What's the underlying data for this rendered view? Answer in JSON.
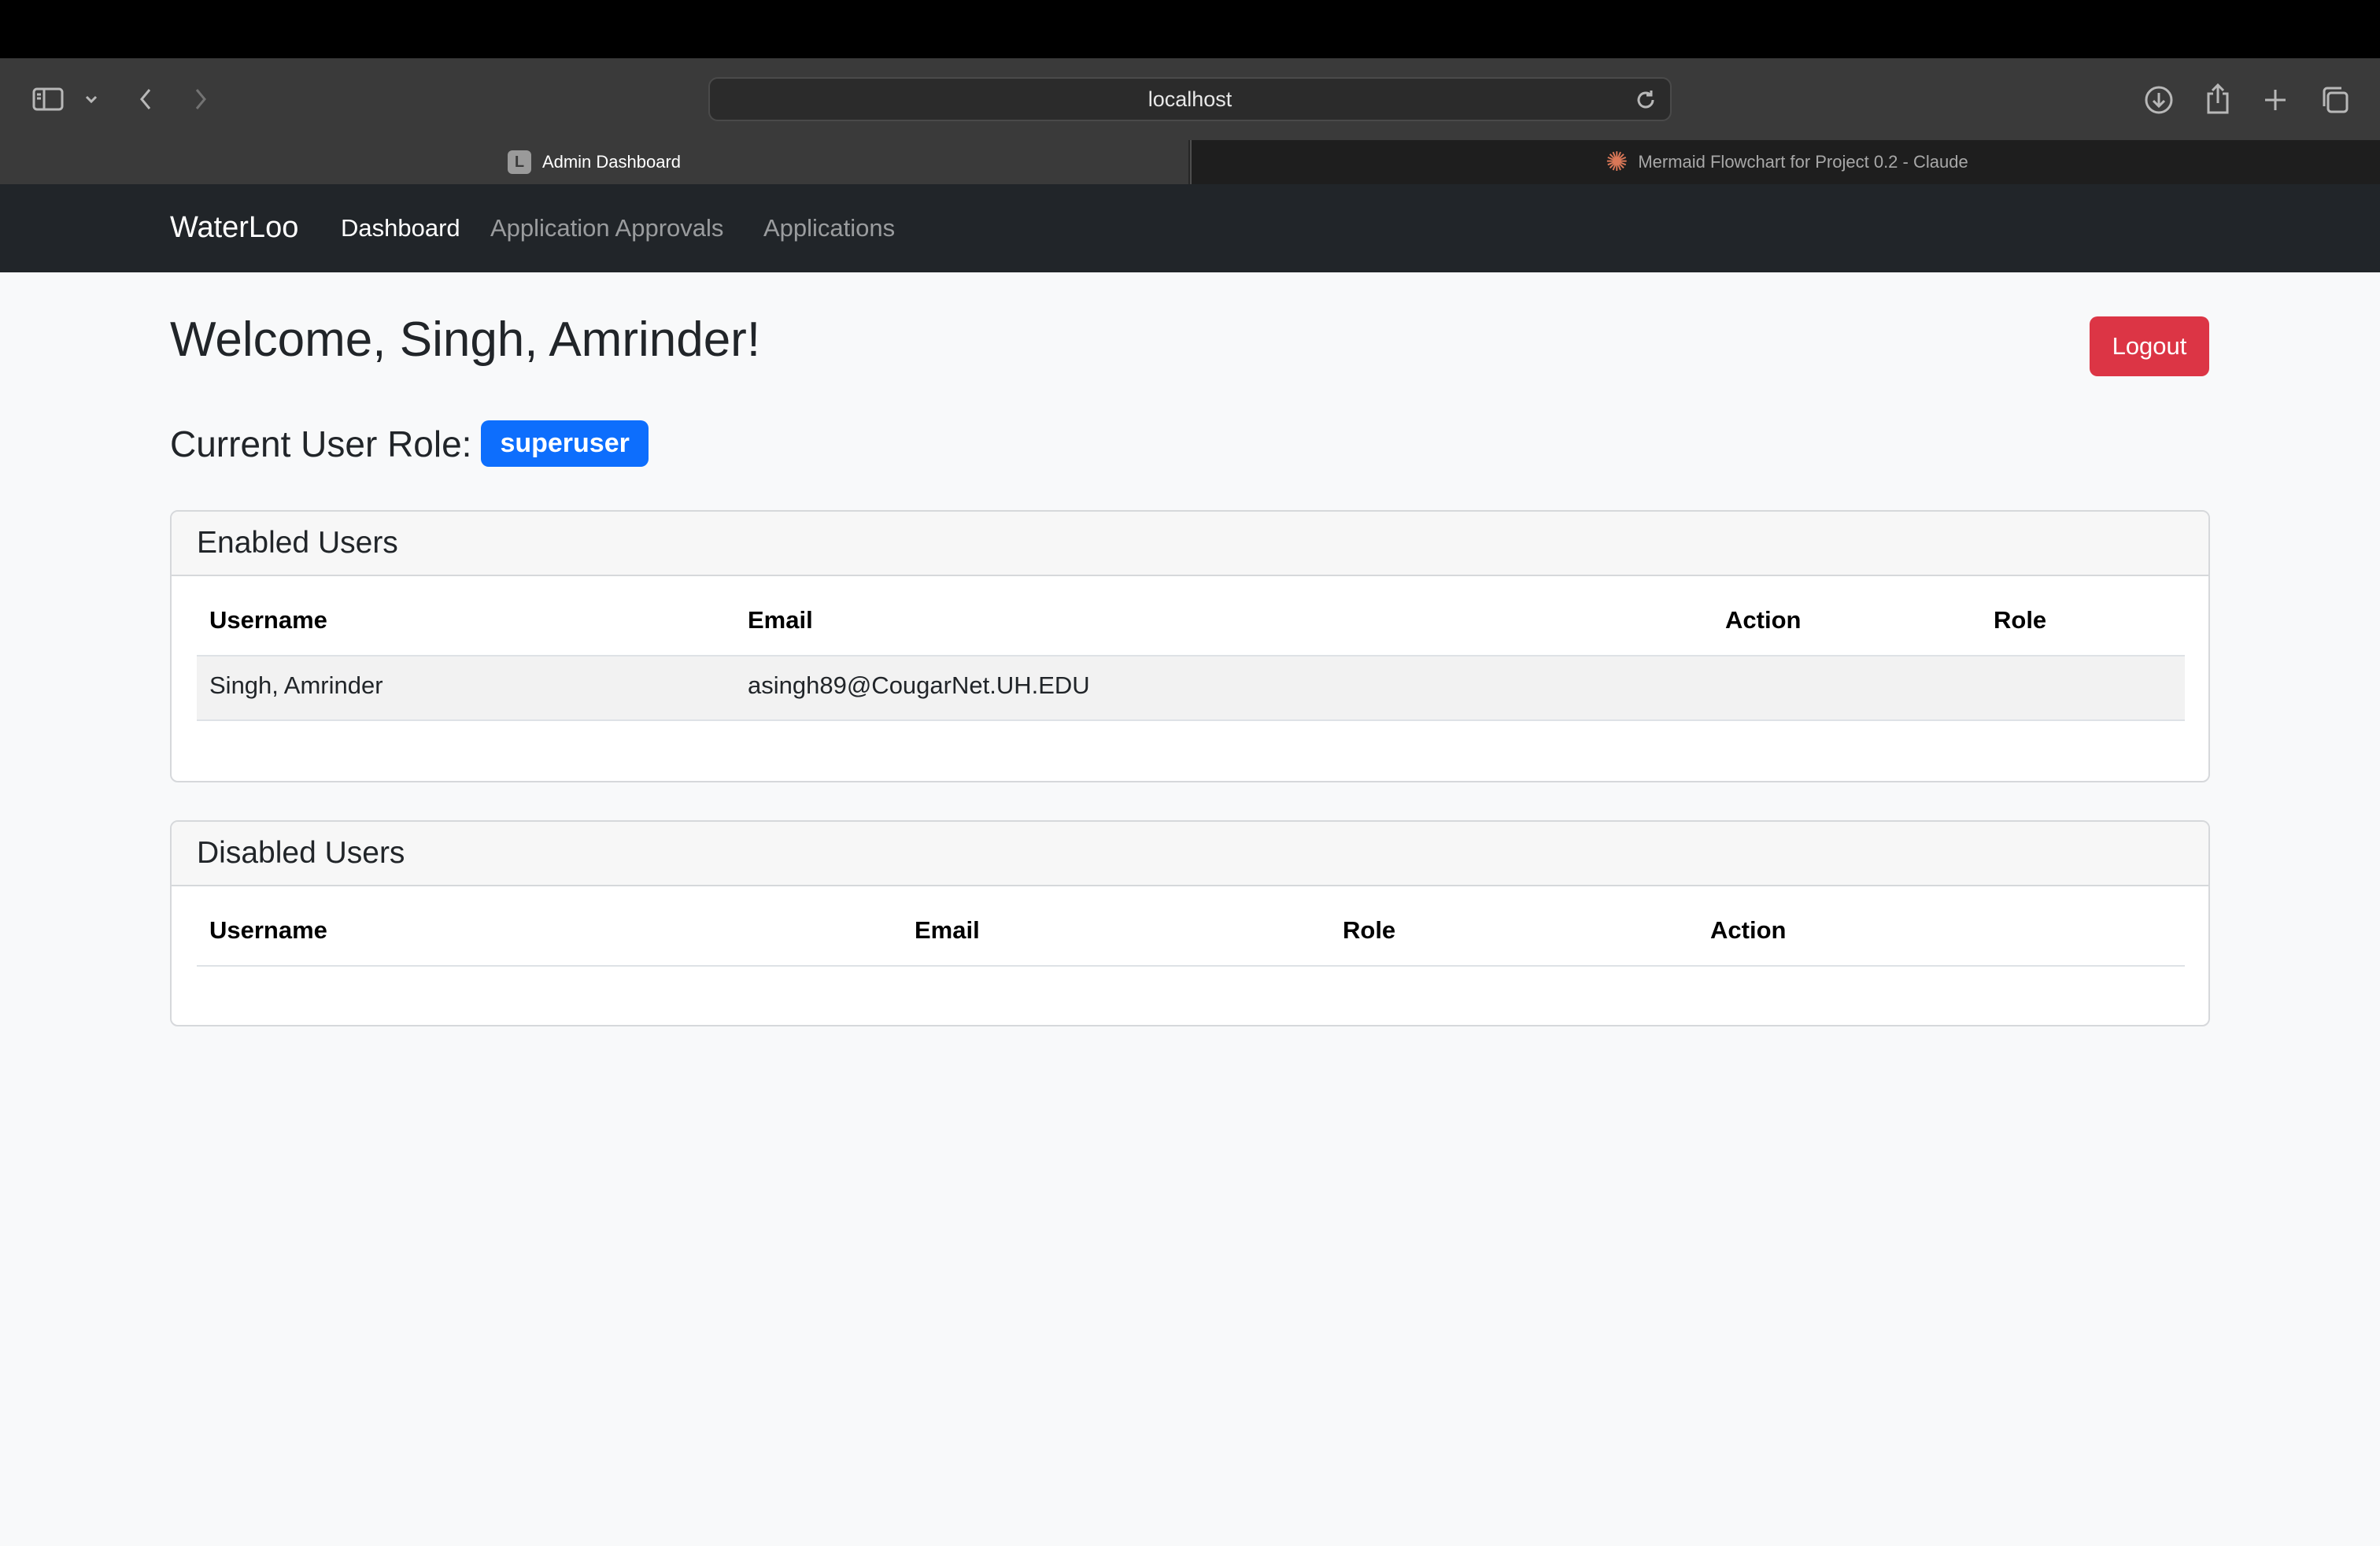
{
  "browser": {
    "url": "localhost",
    "tabs": [
      {
        "label": "Admin Dashboard",
        "favicon": "L",
        "active": true
      },
      {
        "label": "Mermaid Flowchart for Project 0.2 - Claude",
        "favicon": "claude-icon",
        "active": false
      }
    ]
  },
  "navbar": {
    "brand": "WaterLoo",
    "links": [
      {
        "label": "Dashboard",
        "active": true
      },
      {
        "label": "Application Approvals",
        "active": false
      },
      {
        "label": "Applications",
        "active": false
      }
    ]
  },
  "main": {
    "welcome": "Welcome, Singh, Amrinder!",
    "logout_label": "Logout",
    "role_label": "Current User Role:",
    "role_value": "superuser"
  },
  "enabled_users": {
    "title": "Enabled Users",
    "columns": [
      "Username",
      "Email",
      "Action",
      "Role"
    ],
    "rows": [
      {
        "username": "Singh, Amrinder",
        "email": "asingh89@CougarNet.UH.EDU",
        "action": "",
        "role": ""
      }
    ]
  },
  "disabled_users": {
    "title": "Disabled Users",
    "columns": [
      "Username",
      "Email",
      "Role",
      "Action"
    ],
    "rows": []
  },
  "colors": {
    "navbar_bg": "#212529",
    "logout": "#dc3545",
    "badge": "#0d6efd"
  }
}
